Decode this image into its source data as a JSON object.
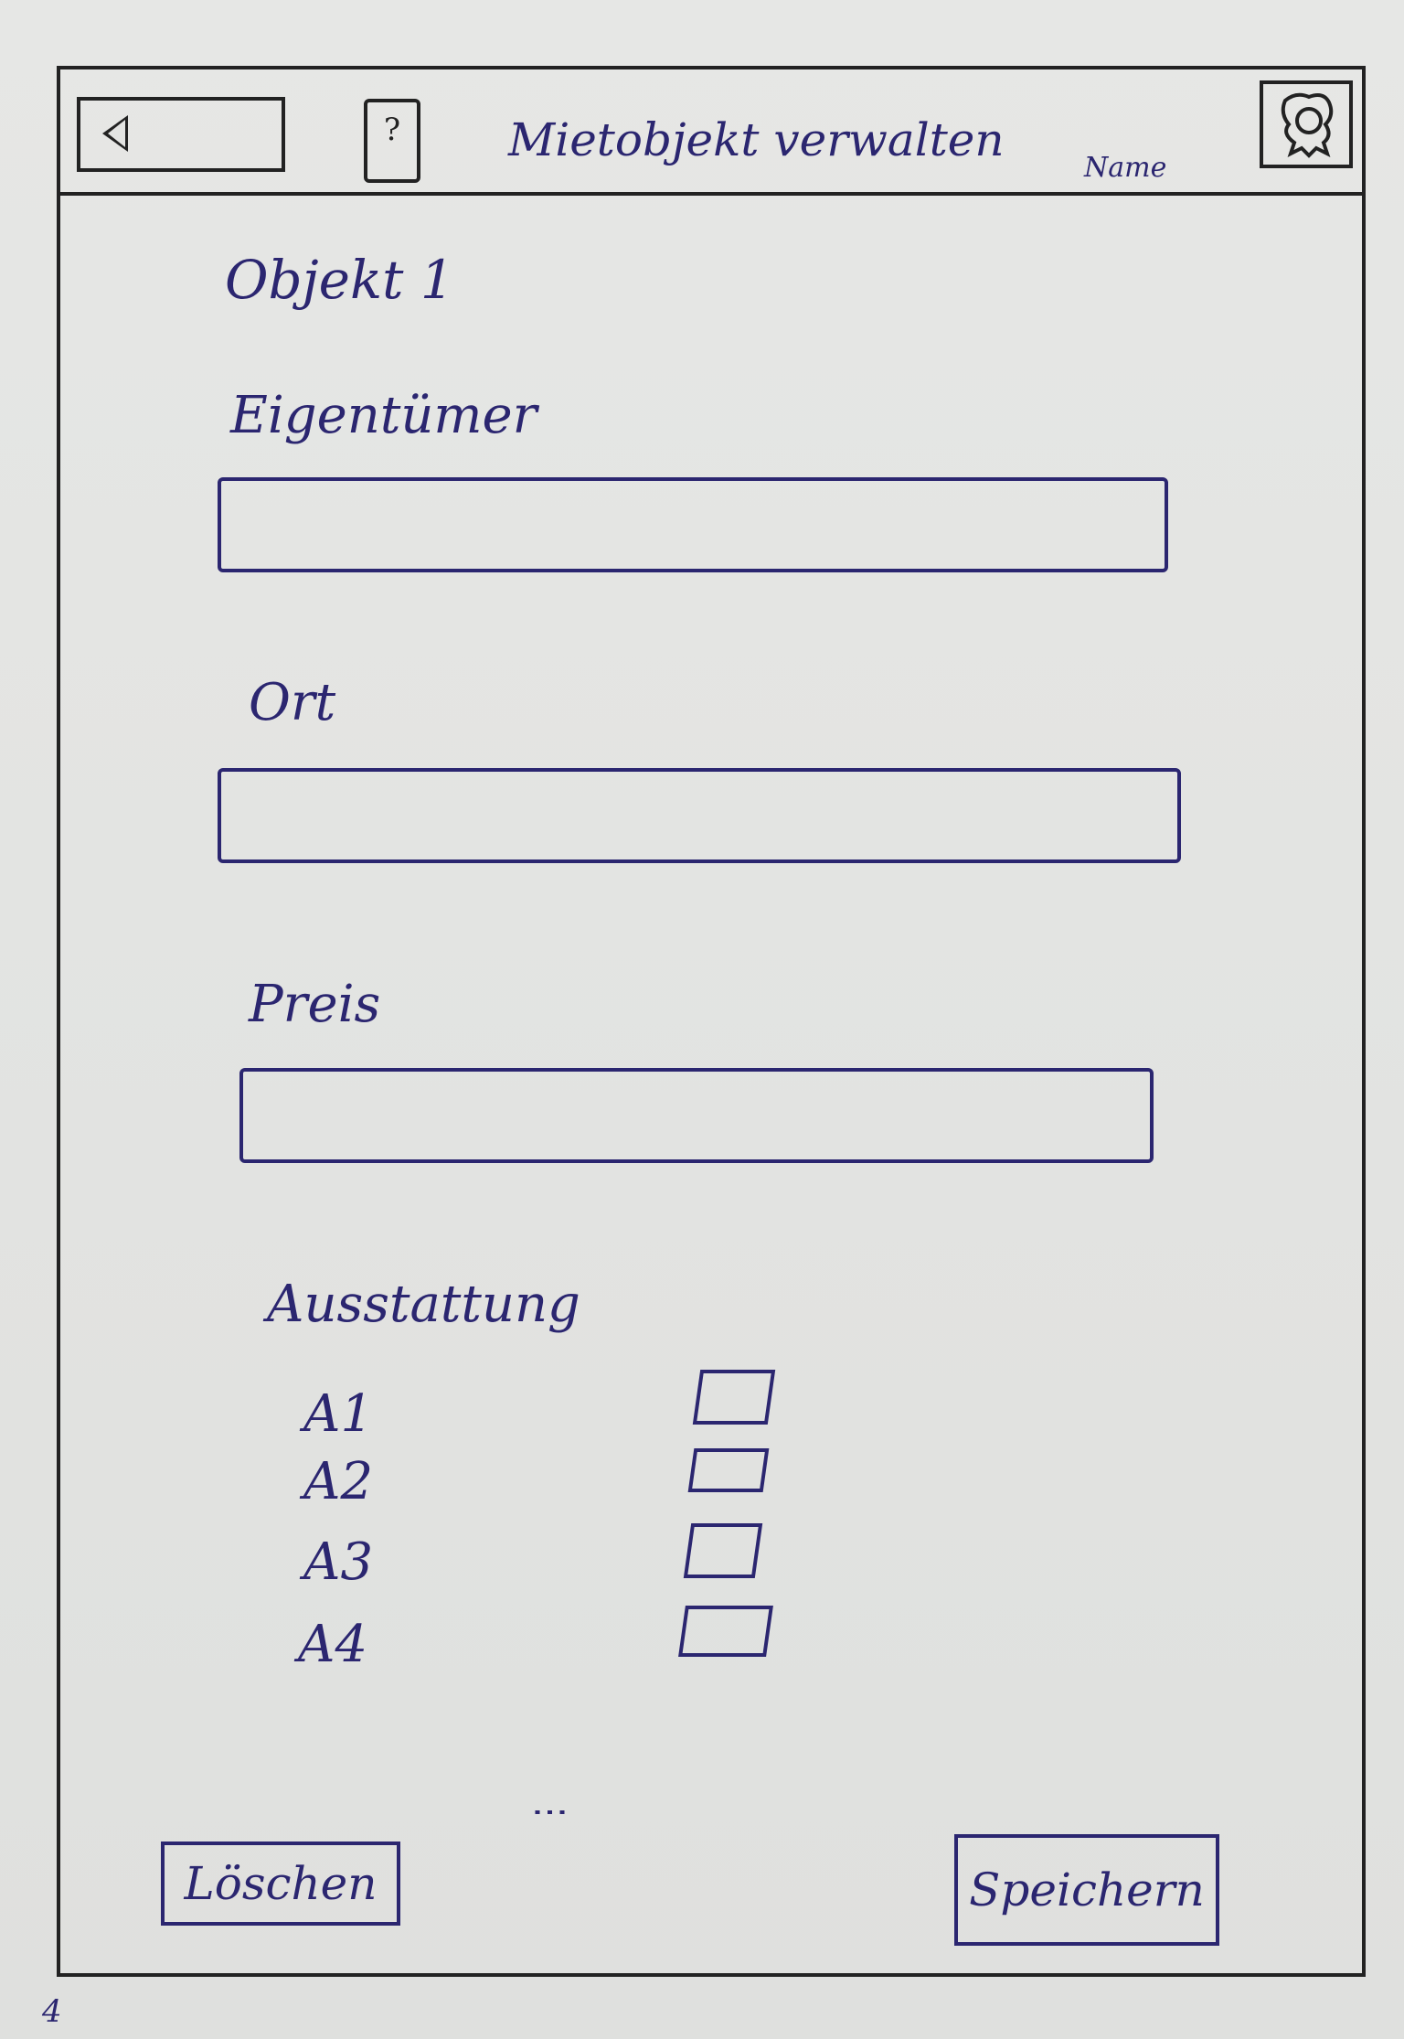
{
  "header": {
    "back_icon": "chevron-left-icon",
    "help_label": "?",
    "title": "Mietobjekt verwalten",
    "user_name": "Name",
    "avatar_icon": "user-avatar-icon"
  },
  "form": {
    "object_title": "Objekt 1",
    "fields": [
      {
        "label": "Eigentümer",
        "value": ""
      },
      {
        "label": "Ort",
        "value": ""
      },
      {
        "label": "Preis",
        "value": ""
      }
    ],
    "equipment": {
      "label": "Ausstattung",
      "options": [
        {
          "label": "A1",
          "checked": false
        },
        {
          "label": "A2",
          "checked": false
        },
        {
          "label": "A3",
          "checked": false
        },
        {
          "label": "A4",
          "checked": false
        }
      ],
      "more_indicator": "⋮"
    }
  },
  "actions": {
    "delete_label": "Löschen",
    "save_label": "Speichern"
  },
  "page_number": "4",
  "colors": {
    "ink_blue": "#2b2670",
    "frame_black": "#222222",
    "paper": "#e3e4e2"
  }
}
